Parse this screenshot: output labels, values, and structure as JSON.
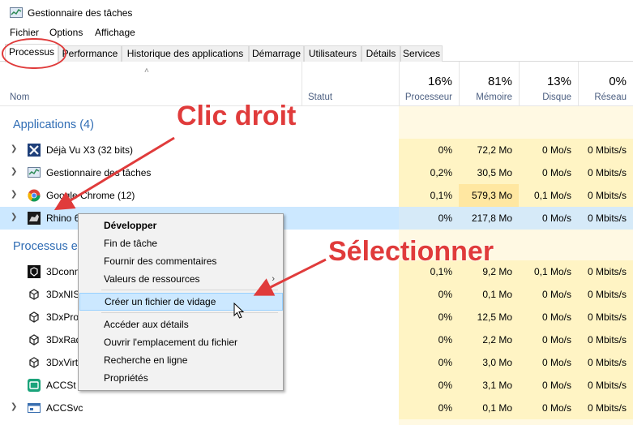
{
  "window": {
    "title": "Gestionnaire des tâches"
  },
  "menu": [
    "Fichier",
    "Options",
    "Affichage"
  ],
  "tabs": [
    "Processus",
    "Performance",
    "Historique des applications",
    "Démarrage",
    "Utilisateurs",
    "Détails",
    "Services"
  ],
  "columns": {
    "name": "Nom",
    "status": "Statut",
    "cpu": {
      "pct": "16%",
      "label": "Processeur"
    },
    "mem": {
      "pct": "81%",
      "label": "Mémoire"
    },
    "disk": {
      "pct": "13%",
      "label": "Disque"
    },
    "net": {
      "pct": "0%",
      "label": "Réseau"
    }
  },
  "groups": {
    "apps": "Applications (4)",
    "background": "Processus e"
  },
  "apps": [
    {
      "name": "Déjà Vu X3 (32 bits)",
      "cpu": "0%",
      "mem": "72,2 Mo",
      "disk": "0 Mo/s",
      "net": "0 Mbits/s",
      "icon": "dejavu-icon"
    },
    {
      "name": "Gestionnaire des tâches",
      "cpu": "0,2%",
      "mem": "30,5 Mo",
      "disk": "0 Mo/s",
      "net": "0 Mbits/s",
      "icon": "taskmgr-icon"
    },
    {
      "name": "Google Chrome (12)",
      "cpu": "0,1%",
      "mem": "579,3 Mo",
      "disk": "0,1 Mo/s",
      "net": "0 Mbits/s",
      "icon": "chrome-icon"
    },
    {
      "name": "Rhino 6",
      "cpu": "0%",
      "mem": "217,8 Mo",
      "disk": "0 Mo/s",
      "net": "0 Mbits/s",
      "icon": "rhino-icon"
    }
  ],
  "background": [
    {
      "name": "3Dconn",
      "cpu": "0,1%",
      "mem": "9,2 Mo",
      "disk": "0,1 Mo/s",
      "net": "0 Mbits/s"
    },
    {
      "name": "3DxNIS",
      "cpu": "0%",
      "mem": "0,1 Mo",
      "disk": "0 Mo/s",
      "net": "0 Mbits/s"
    },
    {
      "name": "3DxPro",
      "cpu": "0%",
      "mem": "12,5 Mo",
      "disk": "0 Mo/s",
      "net": "0 Mbits/s"
    },
    {
      "name": "3DxRad",
      "cpu": "0%",
      "mem": "2,2 Mo",
      "disk": "0 Mo/s",
      "net": "0 Mbits/s"
    },
    {
      "name": "3DxVirt",
      "cpu": "0%",
      "mem": "3,0 Mo",
      "disk": "0 Mo/s",
      "net": "0 Mbits/s"
    },
    {
      "name": "ACCSt",
      "cpu": "0%",
      "mem": "3,1 Mo",
      "disk": "0 Mo/s",
      "net": "0 Mbits/s"
    },
    {
      "name": "ACCSvc",
      "cpu": "0%",
      "mem": "0,1 Mo",
      "disk": "0 Mo/s",
      "net": "0 Mbits/s"
    }
  ],
  "context_menu": {
    "items": [
      "Développer",
      "Fin de tâche",
      "Fournir des commentaires",
      "Valeurs de ressources",
      "Créer un fichier de vidage",
      "Accéder aux détails",
      "Ouvrir l'emplacement du fichier",
      "Recherche en ligne",
      "Propriétés"
    ]
  },
  "annotations": {
    "right_click": "Clic droit",
    "select": "Sélectionner"
  },
  "colors": {
    "annotation": "#e03b3b",
    "group_title": "#2f6cb4",
    "selection": "#cce8ff",
    "metric_bg": "#fff4c4"
  }
}
